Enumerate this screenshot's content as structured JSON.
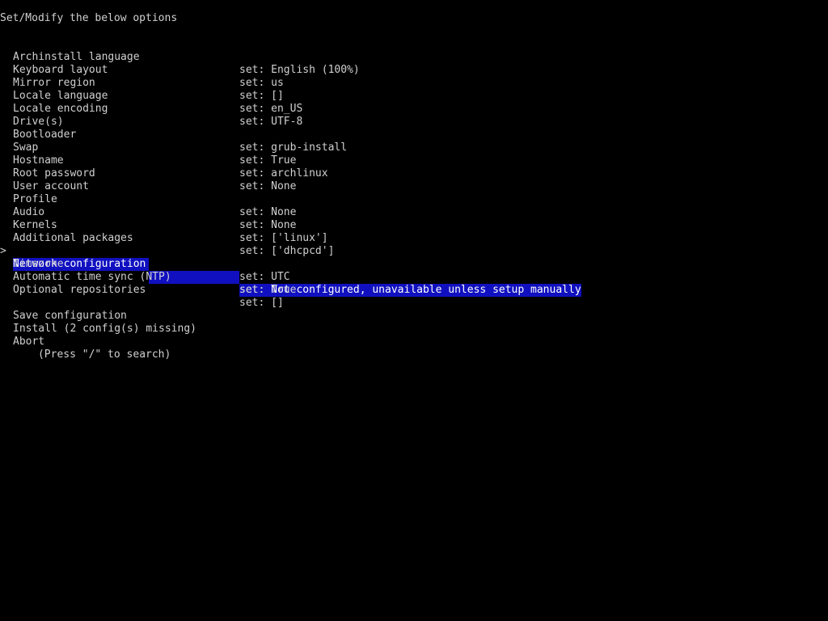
{
  "header": {
    "title": "Set/Modify the below options"
  },
  "cursor": ">",
  "options": [
    {
      "label": "Archinstall language",
      "value": "set: English (100%)"
    },
    {
      "label": "Keyboard layout",
      "value": "set: us"
    },
    {
      "label": "Mirror region",
      "value": "set: []"
    },
    {
      "label": "Locale language",
      "value": "set: en_US"
    },
    {
      "label": "Locale encoding",
      "value": "set: UTF-8"
    },
    {
      "label": "Drive(s)",
      "value": ""
    },
    {
      "label": "Bootloader",
      "value": "set: grub-install"
    },
    {
      "label": "Swap",
      "value": "set: True"
    },
    {
      "label": "Hostname",
      "value": "set: archlinux"
    },
    {
      "label": "Root password",
      "value": "set: None"
    },
    {
      "label": "User account",
      "value": ""
    },
    {
      "label": "Profile",
      "value": "set: None"
    },
    {
      "label": "Audio",
      "value": "set: None"
    },
    {
      "label": "Kernels",
      "value": "set: ['linux']"
    },
    {
      "label": "Additional packages",
      "value": "set: ['dhcpcd']"
    },
    {
      "label": "Network configuration",
      "value": "set: Not configured, unavailable unless setup manually",
      "selected": true
    },
    {
      "label": "Timezone",
      "value": "set: UTC"
    },
    {
      "label": "Automatic time sync (NTP)",
      "value": "set: True"
    },
    {
      "label": "Optional repositories",
      "value": "set: []"
    }
  ],
  "actions": [
    {
      "label": "Save configuration"
    },
    {
      "label": "Install (2 config(s) missing)"
    },
    {
      "label": "Abort"
    }
  ],
  "footer": {
    "hint": "(Press \"/\" to search)"
  },
  "colors": {
    "background": "#000000",
    "text": "#d0d0d0",
    "highlight": "#1010c0"
  }
}
